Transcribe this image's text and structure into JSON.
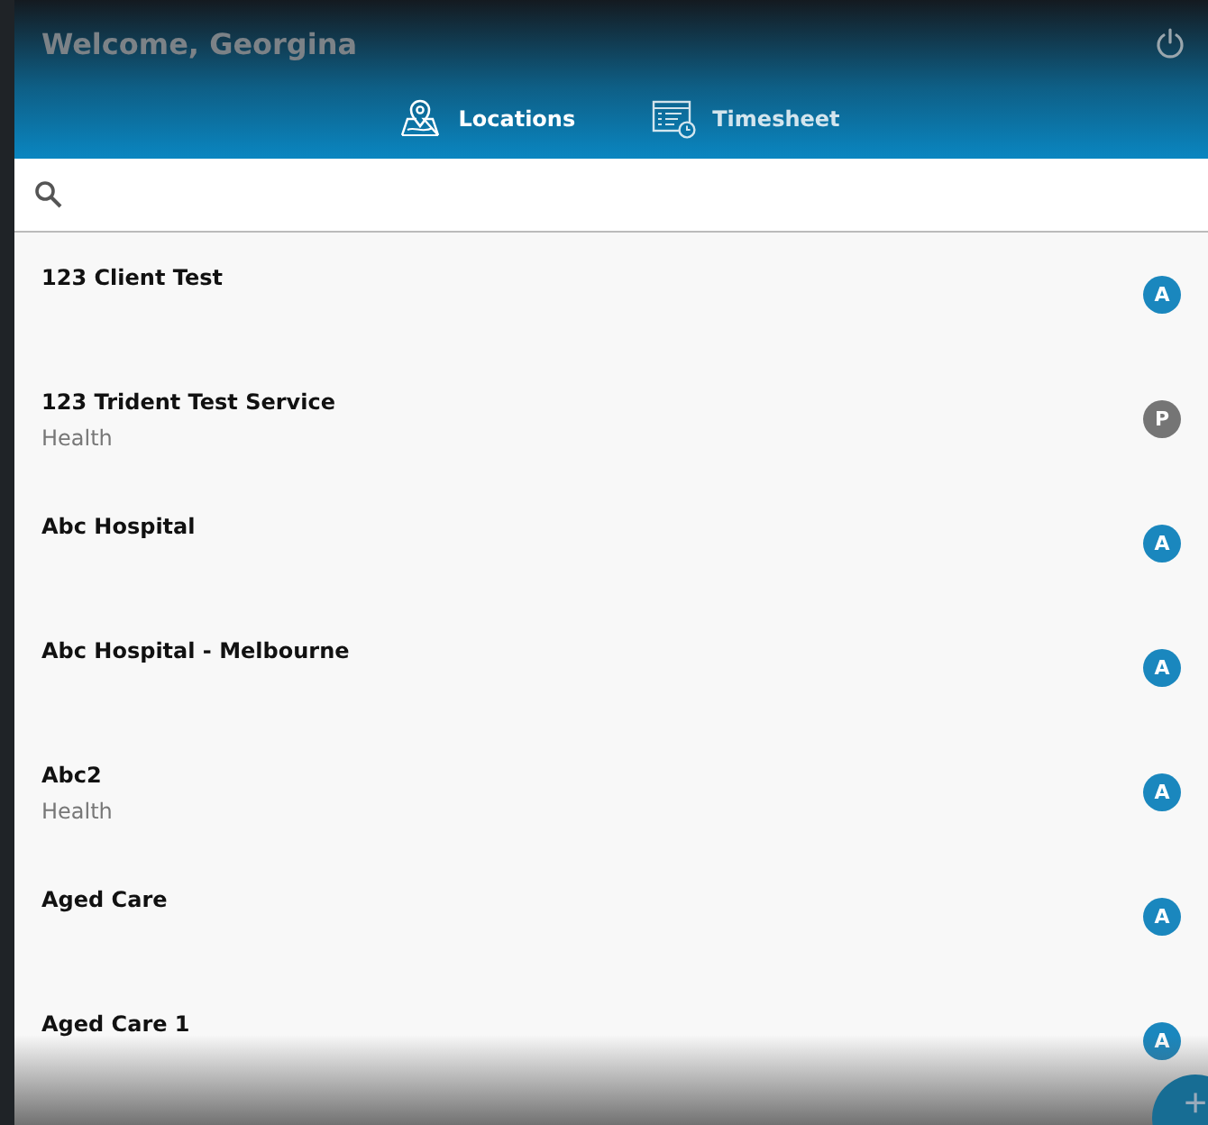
{
  "header": {
    "title": "Welcome, Georgina"
  },
  "tabs": [
    {
      "label": "Locations",
      "kind": "map",
      "selected": true
    },
    {
      "label": "Timesheet",
      "kind": "sheet",
      "selected": false
    }
  ],
  "locations": [
    {
      "name": "123 Client Test",
      "badge": "A",
      "color": "#1a87be"
    },
    {
      "name": "123 Trident Test Service",
      "subtitle": "Health",
      "badge": "P",
      "color": "#757575"
    },
    {
      "name": "Abc Hospital",
      "badge": "A",
      "color": "#1a87be"
    },
    {
      "name": "Abc Hospital - Melbourne",
      "badge": "A",
      "color": "#1a87be"
    },
    {
      "name": "Abc2",
      "subtitle": "Health",
      "badge": "A",
      "color": "#1a87be"
    },
    {
      "name": "Aged Care",
      "badge": "A",
      "color": "#1a87be"
    },
    {
      "name": "Aged Care 1",
      "badge": "A",
      "color": "#1a87be"
    }
  ],
  "fab": {
    "label": "+"
  }
}
